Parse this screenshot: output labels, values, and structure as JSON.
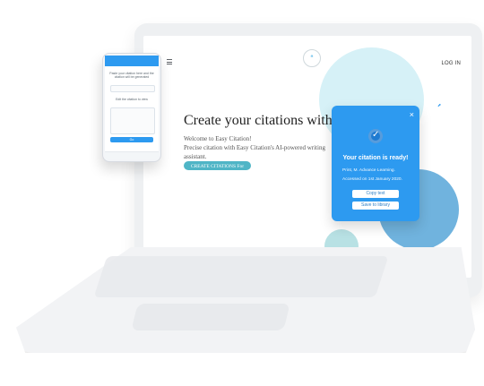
{
  "website": {
    "header": {
      "login": "LOG IN"
    },
    "hero": {
      "title": "Create your citations with ease.",
      "welcome": "Welcome to Easy Citation!",
      "description": "Precise citation with Easy Citation's AI-powered writing assistant.",
      "cta": "CREATE CITATIONS For Free!"
    },
    "popup": {
      "title": "Your citation is ready!",
      "citation_line_1": "Print, M. Advance Learning.",
      "citation_line_2": "Accessed on 1st January 2020.",
      "buttons": {
        "copy": "Copy text",
        "save": "Save to library"
      },
      "close": "×"
    }
  },
  "phone": {
    "message_1": "Paste your citation here and the citation will be generated",
    "message_2": "Edit the citation to view",
    "button": "Go"
  },
  "colors": {
    "accent": "#2d9af0",
    "cta": "#4fb5c6"
  },
  "icons": {
    "logo": "speech-bubble-icon",
    "close": "close-icon",
    "check": "check-icon",
    "menu": "hamburger-icon"
  }
}
